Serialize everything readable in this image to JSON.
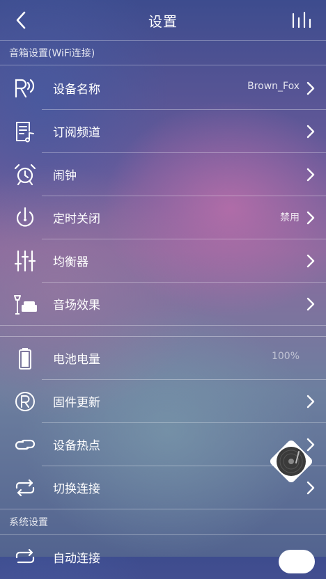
{
  "nav": {
    "title": "设置",
    "back_icon": "chevron-left-icon",
    "right_icon": "equalizer-bars-icon"
  },
  "sections": {
    "speaker": "音箱设置(WiFi连接)",
    "system": "系统设置"
  },
  "speaker_items": [
    {
      "icon": "speaker-r-signal-icon",
      "label": "设备名称",
      "value": "Brown_Fox"
    },
    {
      "icon": "subscribe-channel-icon",
      "label": "订阅频道",
      "value": ""
    },
    {
      "icon": "alarm-clock-icon",
      "label": "闹钟",
      "value": ""
    },
    {
      "icon": "timer-power-icon",
      "label": "定时关闭",
      "value": "禁用"
    },
    {
      "icon": "equalizer-sliders-icon",
      "label": "均衡器",
      "value": ""
    },
    {
      "icon": "sound-field-sofa-icon",
      "label": "音场效果",
      "value": ""
    }
  ],
  "device_items": [
    {
      "icon": "battery-icon",
      "label": "电池电量",
      "value": "100%"
    },
    {
      "icon": "registered-r-icon",
      "label": "固件更新",
      "value": ""
    },
    {
      "icon": "hotspot-link-icon",
      "label": "设备热点",
      "value": ""
    },
    {
      "icon": "switch-connection-icon",
      "label": "切换连接",
      "value": ""
    }
  ],
  "system_items": [
    {
      "icon": "auto-connect-icon",
      "label": "自动连接",
      "toggle_on": true
    }
  ],
  "floating": {
    "icon": "vinyl-disc-icon"
  }
}
